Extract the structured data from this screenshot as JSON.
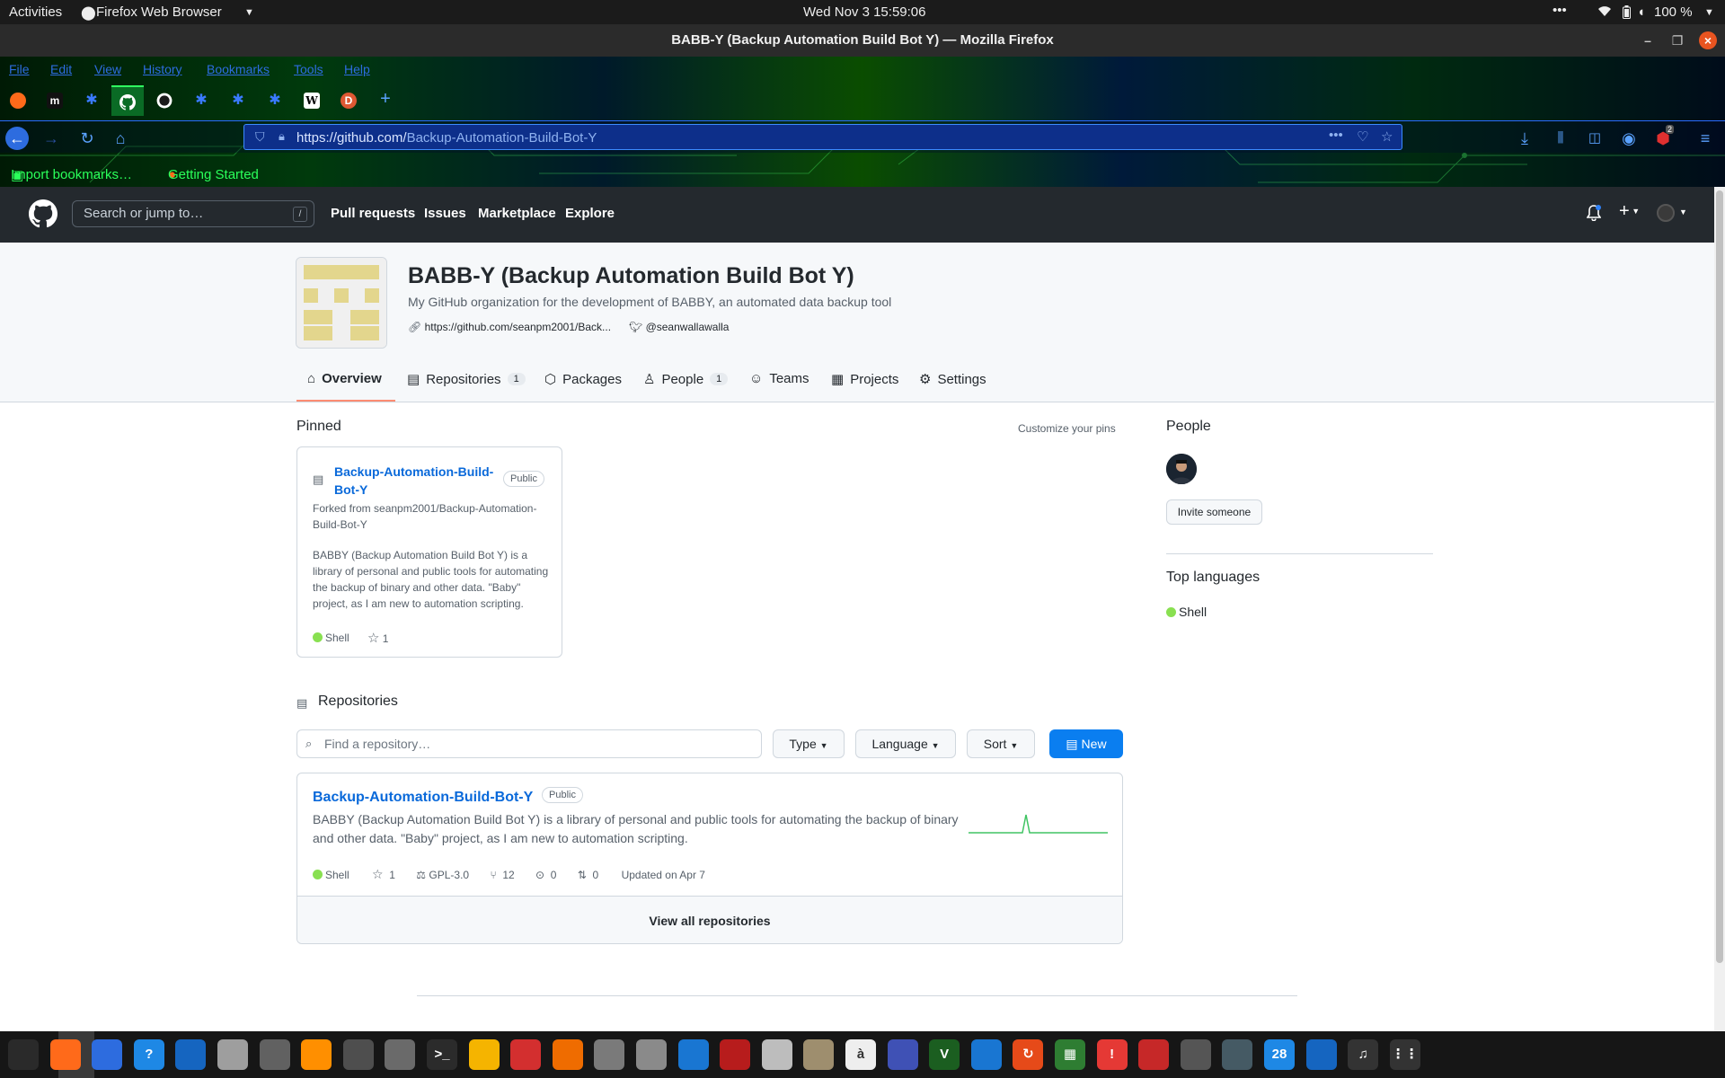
{
  "gnome": {
    "activities": "Activities",
    "app_menu": "Firefox Web Browser",
    "clock": "Wed Nov 3  15:59:06",
    "battery": "100 %",
    "more": "•••"
  },
  "window": {
    "title": "BABB-Y (Backup Automation Build Bot Y) — Mozilla Firefox"
  },
  "menubar": [
    "File",
    "Edit",
    "View",
    "History",
    "Bookmarks",
    "Tools",
    "Help"
  ],
  "tabs": [
    {
      "icon": "firefox-icon",
      "glyph": "",
      "color": "#ff6a1a"
    },
    {
      "icon": "m-icon",
      "glyph": "m",
      "color": "#111111"
    },
    {
      "icon": "puzzle-icon",
      "glyph": "✱",
      "color": "#2d6cdf"
    },
    {
      "icon": "github-icon",
      "glyph": "",
      "color": "#0a6b25"
    },
    {
      "icon": "github-icon",
      "glyph": "",
      "color": "#1a1a1a"
    },
    {
      "icon": "puzzle-icon",
      "glyph": "✱",
      "color": "#2d6cdf"
    },
    {
      "icon": "puzzle-icon",
      "glyph": "✱",
      "color": "#2d6cdf"
    },
    {
      "icon": "puzzle-icon",
      "glyph": "✱",
      "color": "#2d6cdf"
    },
    {
      "icon": "wikipedia-icon",
      "glyph": "W",
      "color": "#ffffff"
    },
    {
      "icon": "duckduckgo-icon",
      "glyph": "D",
      "color": "#de5833"
    }
  ],
  "url": {
    "prefix": "https://github.com/",
    "path": "Backup-Automation-Build-Bot-Y"
  },
  "bookmarks": {
    "import": "Import bookmarks…",
    "getting_started": "Getting Started",
    "badge": "2"
  },
  "github": {
    "search_placeholder": "Search or jump to…",
    "search_key": "/",
    "nav": [
      "Pull requests",
      "Issues",
      "Marketplace",
      "Explore"
    ]
  },
  "org": {
    "name": "BABB-Y (Backup Automation Build Bot Y)",
    "description": "My GitHub organization for the development of BABBY, an automated data backup tool",
    "link": "https://github.com/seanpm2001/Back...",
    "twitter": "@seanwallawalla",
    "tabs": [
      {
        "label": "Overview",
        "count": ""
      },
      {
        "label": "Repositories",
        "count": "1"
      },
      {
        "label": "Packages",
        "count": ""
      },
      {
        "label": "People",
        "count": "1"
      },
      {
        "label": "Teams",
        "count": ""
      },
      {
        "label": "Projects",
        "count": ""
      },
      {
        "label": "Settings",
        "count": ""
      }
    ]
  },
  "pinned": {
    "heading": "Pinned",
    "customize": "Customize your pins",
    "card": {
      "name_line1": "Backup-Automation-Build-",
      "name_line2": "Bot-Y",
      "visibility": "Public",
      "fork_line1": "Forked from seanpm2001/Backup-Automation-",
      "fork_line2": "Build-Bot-Y",
      "desc_lines": [
        "BABBY (Backup Automation Build Bot Y) is a",
        "library of personal and public tools for automating",
        "the backup of binary and other data. \"Baby\"",
        "project, as I am new to automation scripting."
      ],
      "language": "Shell",
      "stars": "1"
    }
  },
  "repositories": {
    "heading": "Repositories",
    "find_placeholder": "Find a repository…",
    "type_label": "Type",
    "language_label": "Language",
    "sort_label": "Sort",
    "new_label": "New",
    "item": {
      "name": "Backup-Automation-Build-Bot-Y",
      "visibility": "Public",
      "desc_line1": "BABBY (Backup Automation Build Bot Y) is a library of personal and public tools for automating the backup of binary",
      "desc_line2": "and other data. \"Baby\" project, as I am new to automation scripting.",
      "language": "Shell",
      "stars": "1",
      "license": "GPL-3.0",
      "forks": "12",
      "issues": "0",
      "pulls": "0",
      "updated": "Updated on Apr 7"
    },
    "view_all": "View all repositories"
  },
  "sidebar": {
    "people_heading": "People",
    "invite": "Invite someone",
    "top_languages_heading": "Top languages",
    "top_language": "Shell"
  },
  "dock": {
    "calendar_day": "28",
    "icons": [
      "system-monitor-icon",
      "firefox-icon",
      "text-editor-icon",
      "help-icon",
      "notes-icon",
      "files-icon",
      "settings-icon",
      "vlc-icon",
      "gimp-icon",
      "software-updater-icon",
      "terminal-icon",
      "calculator-icon",
      "system-graph-icon",
      "app-store-icon",
      "screenshot-icon",
      "disk-icon",
      "writer-icon",
      "image-viewer-icon",
      "font-viewer-icon",
      "archive-icon",
      "character-map-icon",
      "tasks-icon",
      "vim-icon",
      "virtualbox-icon",
      "update-icon",
      "spreadsheet-icon",
      "alert-icon",
      "game-icon",
      "camera-icon",
      "airplane-icon",
      "calendar-icon",
      "thunderbird-icon",
      "music-icon",
      "app-grid-icon"
    ]
  },
  "colors": {
    "accent": "#0969da",
    "new_button": "#0a7ef0",
    "shell": "#89e051",
    "tab_underline": "#fd8c73"
  }
}
